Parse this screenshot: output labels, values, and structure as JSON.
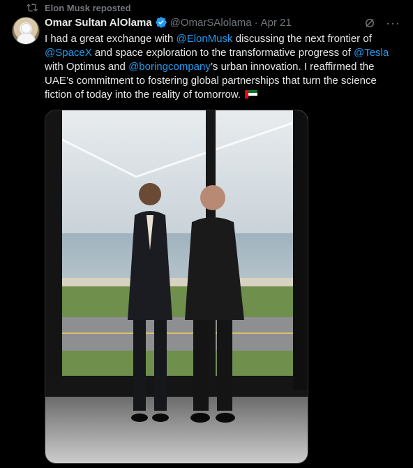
{
  "repost": {
    "label": "Elon Musk reposted",
    "icon": "repost-icon"
  },
  "author": {
    "display_name": "Omar Sultan AlOlama",
    "verified_icon": "verified-badge-icon",
    "handle": "@OmarSAlolama",
    "separator": "·",
    "date": "Apr 21"
  },
  "actions": {
    "grok_icon": "grok-icon",
    "more_label": "···"
  },
  "tweet_text": {
    "line1_a": "I had a great exchange with ",
    "mention1": "@ElonMusk",
    "line1_b": " discussing the next frontier of ",
    "mention2": "@SpaceX",
    "line2_a": " and space exploration to the transformative progress of ",
    "mention3": "@Tesla",
    "line3_a": " with Optimus and ",
    "mention4": "@boringcompany",
    "line3_b": "’s urban innovation. I reaffirmed the UAE’s commitment to fostering global partnerships that turn the science fiction of today into the reality of tomorrow. ",
    "flag_icon": "uae-flag-icon"
  },
  "colors": {
    "background": "#000000",
    "text": "#e7e9ea",
    "muted": "#71767b",
    "link": "#1d9bf0"
  }
}
